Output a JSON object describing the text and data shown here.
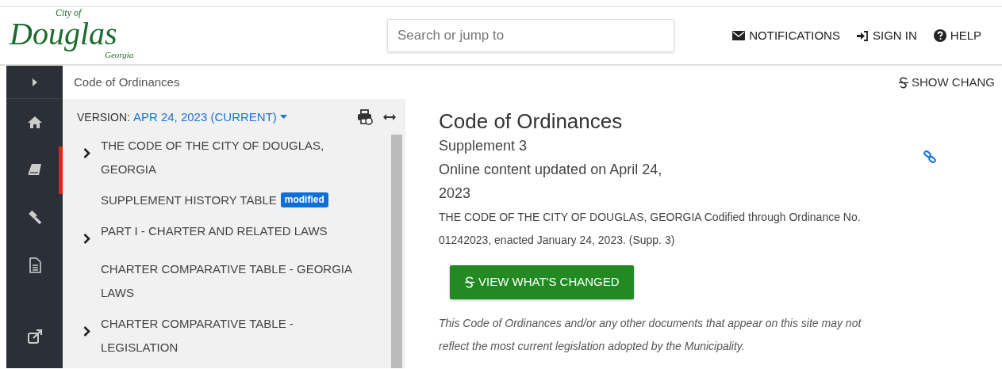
{
  "logo": {
    "line_1": "City of",
    "line_2": "Douglas",
    "line_3": "Georgia"
  },
  "search": {
    "placeholder": "Search or jump to"
  },
  "nav_links": [
    {
      "kind": "notifications",
      "label": "NOTIFICATIONS"
    },
    {
      "kind": "signin",
      "label": "SIGN IN"
    },
    {
      "kind": "help",
      "label": "HELP"
    }
  ],
  "rail_items": [
    {
      "kind": "home",
      "selected": false
    },
    {
      "kind": "book",
      "selected": true
    },
    {
      "kind": "gavel",
      "selected": false
    },
    {
      "kind": "document",
      "selected": false
    },
    {
      "kind": "external",
      "selected": false
    }
  ],
  "breadcrumb": "Code of Ordinances",
  "show_changes": "SHOW CHANG",
  "toc": {
    "version_label": "VERSION:",
    "version": "APR 24, 2023 (CURRENT)",
    "items": [
      {
        "label": "THE CODE OF THE CITY OF DOUGLAS, GEORGIA",
        "expandable": true
      },
      {
        "label": "SUPPLEMENT HISTORY TABLE",
        "expandable": false,
        "badge": "modified"
      },
      {
        "label": "PART I - CHARTER AND RELATED LAWS",
        "expandable": true
      },
      {
        "label": "CHARTER COMPARATIVE TABLE - GEORGIA LAWS",
        "expandable": false
      },
      {
        "label": "CHARTER COMPARATIVE TABLE - LEGISLATION",
        "expandable": true
      }
    ]
  },
  "document": {
    "title": "Code of Ordinances",
    "supplement": "Supplement 3",
    "updated": "Online content updated on April 24, 2023",
    "codified": "THE CODE OF THE CITY OF DOUGLAS, GEORGIA Codified through Ordinance No. 01242023, enacted January 24, 2023. (Supp. 3)",
    "button": "VIEW WHAT'S CHANGED",
    "disclaimer": "This Code of Ordinances and/or any other documents that appear on this site may not reflect the most current legislation adopted by the Municipality."
  }
}
